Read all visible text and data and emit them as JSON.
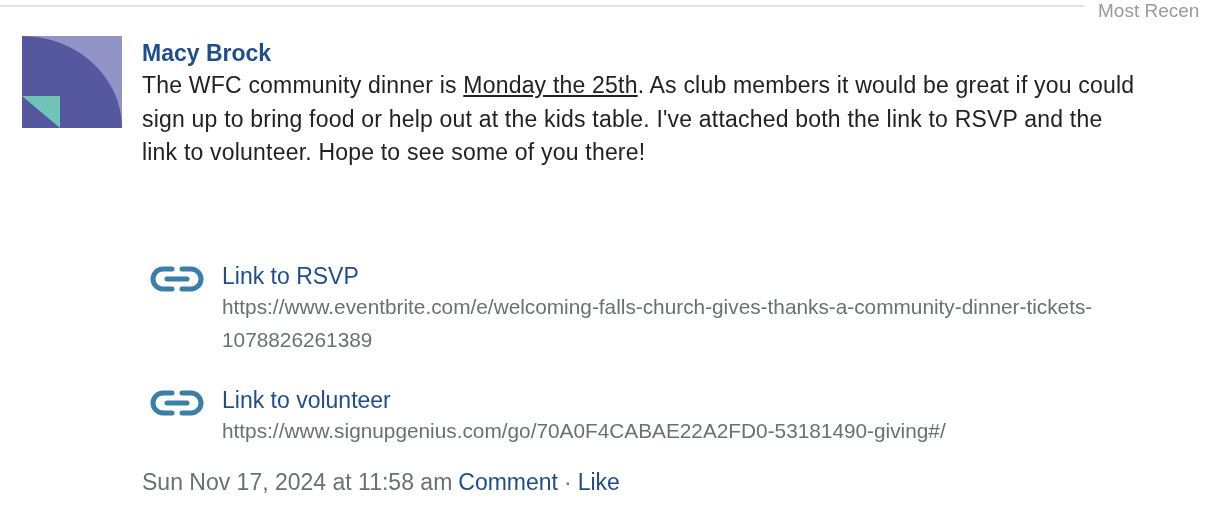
{
  "sort_label": "Most Recen",
  "post": {
    "author": "Macy Brock",
    "body": [
      {
        "text": "The WFC community dinner is ",
        "underlined": false
      },
      {
        "text": "Monday the 25th",
        "underlined": true
      },
      {
        "text": ". As club members it would be great if you could sign up to bring food or help out at the kids table. I've attached both the link to RSVP and the link to volunteer. Hope to see some of you there!",
        "underlined": false
      }
    ],
    "attachments": [
      {
        "title": "Link to RSVP",
        "url": "https://www.eventbrite.com/e/welcoming-falls-church-gives-thanks-a-community-dinner-tickets-1078826261389"
      },
      {
        "title": "Link to volunteer",
        "url": "https://www.signupgenius.com/go/70A0F4CABAE22A2FD0-53181490-giving#/"
      }
    ],
    "timestamp": "Sun Nov 17, 2024 at 11:58 am",
    "actions": [
      "Comment",
      "Like"
    ],
    "separator": "·"
  }
}
